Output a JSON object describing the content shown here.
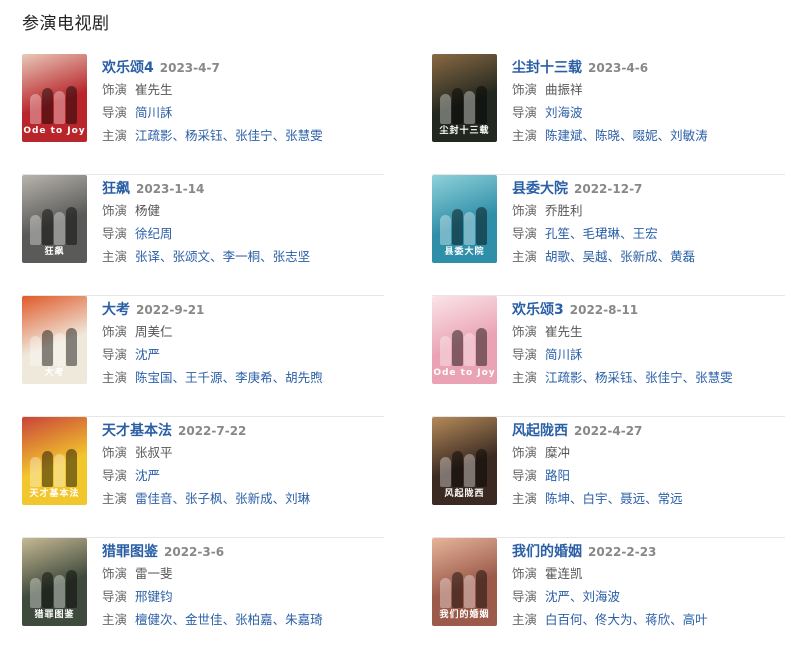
{
  "section_title": "参演电视剧",
  "labels": {
    "role": "饰演",
    "director": "导演",
    "cast": "主演"
  },
  "dramas": [
    {
      "title": "欢乐颂4",
      "date": "2023-4-7",
      "role": "崔先生",
      "directors": [
        "简川訸"
      ],
      "cast": [
        "江疏影",
        "杨采钰",
        "张佳宁",
        "张慧雯"
      ],
      "poster": {
        "bg": "#b8252b",
        "accent": "#e9c9b9",
        "text": "Ode to Joy"
      }
    },
    {
      "title": "尘封十三载",
      "date": "2023-4-6",
      "role": "曲振祥",
      "directors": [
        "刘海波"
      ],
      "cast": [
        "陈建斌",
        "陈晓",
        "啜妮",
        "刘敏涛"
      ],
      "poster": {
        "bg": "#22271f",
        "accent": "#8a6a44",
        "text": "尘封十三载"
      }
    },
    {
      "title": "狂飙",
      "date": "2023-1-14",
      "role": "杨健",
      "directors": [
        "徐纪周"
      ],
      "cast": [
        "张译",
        "张颂文",
        "李一桐",
        "张志坚"
      ],
      "poster": {
        "bg": "#5a5a58",
        "accent": "#b8b4ad",
        "text": "狂飙"
      }
    },
    {
      "title": "县委大院",
      "date": "2022-12-7",
      "role": "乔胜利",
      "directors": [
        "孔笙",
        "毛珺琳",
        "王宏"
      ],
      "cast": [
        "胡歌",
        "吴越",
        "张新成",
        "黄磊"
      ],
      "poster": {
        "bg": "#2f8fa8",
        "accent": "#8fd1da",
        "text": "县委大院"
      }
    },
    {
      "title": "大考",
      "date": "2022-9-21",
      "role": "周美仁",
      "directors": [
        "沈严"
      ],
      "cast": [
        "陈宝国",
        "王千源",
        "李庚希",
        "胡先煦"
      ],
      "poster": {
        "bg": "#efe9dc",
        "accent": "#e05a2a",
        "text": "大考"
      }
    },
    {
      "title": "欢乐颂3",
      "date": "2022-8-11",
      "role": "崔先生",
      "directors": [
        "简川訸"
      ],
      "cast": [
        "江疏影",
        "杨采钰",
        "张佳宁",
        "张慧雯"
      ],
      "poster": {
        "bg": "#e9a3b4",
        "accent": "#fbe4e9",
        "text": "Ode to Joy"
      }
    },
    {
      "title": "天才基本法",
      "date": "2022-7-22",
      "role": "张叔平",
      "directors": [
        "沈严"
      ],
      "cast": [
        "雷佳音",
        "张子枫",
        "张新成",
        "刘琳"
      ],
      "poster": {
        "bg": "#f2c62d",
        "accent": "#c9443a",
        "text": "天才基本法"
      }
    },
    {
      "title": "风起陇西",
      "date": "2022-4-27",
      "role": "糜冲",
      "directors": [
        "路阳"
      ],
      "cast": [
        "陈坤",
        "白宇",
        "聂远",
        "常远"
      ],
      "poster": {
        "bg": "#3a2a22",
        "accent": "#b58a5a",
        "text": "风起陇西"
      }
    },
    {
      "title": "猎罪图鉴",
      "date": "2022-3-6",
      "role": "雷一斐",
      "directors": [
        "邢键钧"
      ],
      "cast": [
        "檀健次",
        "金世佳",
        "张柏嘉",
        "朱嘉琦"
      ],
      "poster": {
        "bg": "#3e4a3c",
        "accent": "#c7b994",
        "text": "猎罪图鉴"
      }
    },
    {
      "title": "我们的婚姻",
      "date": "2022-2-23",
      "role": "霍连凯",
      "directors": [
        "沈严",
        "刘海波"
      ],
      "cast": [
        "白百何",
        "佟大为",
        "蒋欣",
        "高叶"
      ],
      "poster": {
        "bg": "#9b5a4a",
        "accent": "#e6b49a",
        "text": "我们的婚姻"
      }
    }
  ]
}
